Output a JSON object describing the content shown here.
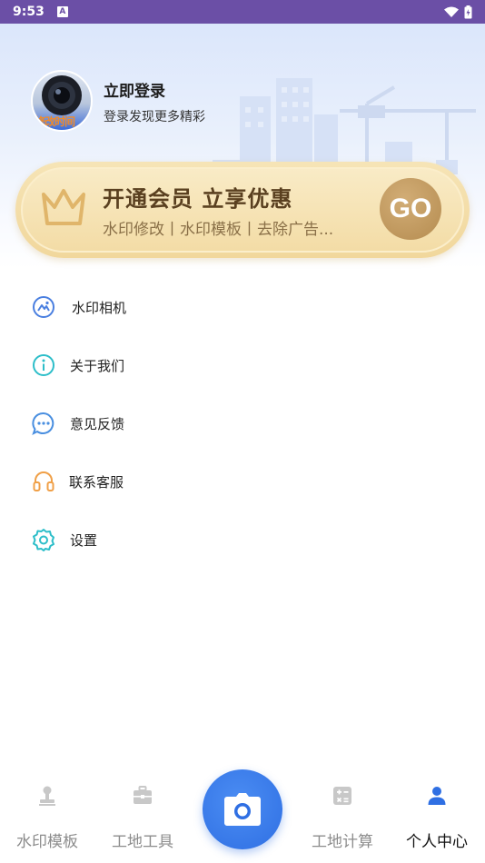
{
  "status_bar": {
    "time": "9:53",
    "notification_glyph": "A"
  },
  "profile": {
    "title": "立即登录",
    "subtitle": "登录发现更多精彩",
    "avatar_caption": "修改时间"
  },
  "vip": {
    "title": "开通会员 立享优惠",
    "description": "水印修改丨水印模板丨去除广告...",
    "go_label": "GO"
  },
  "menu": [
    {
      "label": "水印相机",
      "icon": "watermark-camera-icon",
      "color": "#4a7fe0"
    },
    {
      "label": "关于我们",
      "icon": "info-icon",
      "color": "#2dbec9"
    },
    {
      "label": "意见反馈",
      "icon": "chat-bubble-icon",
      "color": "#4a8fe0"
    },
    {
      "label": "联系客服",
      "icon": "headset-icon",
      "color": "#f0a048"
    },
    {
      "label": "设置",
      "icon": "gear-icon",
      "color": "#2dbec9"
    }
  ],
  "tabs": [
    {
      "label": "水印模板",
      "icon": "stamp-icon",
      "active": false
    },
    {
      "label": "工地工具",
      "icon": "toolbox-icon",
      "active": false
    },
    {
      "label": "工地计算",
      "icon": "calculator-icon",
      "active": false
    },
    {
      "label": "个人中心",
      "icon": "person-icon",
      "active": true
    }
  ],
  "colors": {
    "status_bar": "#6b4fa6",
    "accent_blue": "#2f6fe3",
    "vip_gold": "#f1d79c",
    "go_button": "#b58c50"
  }
}
